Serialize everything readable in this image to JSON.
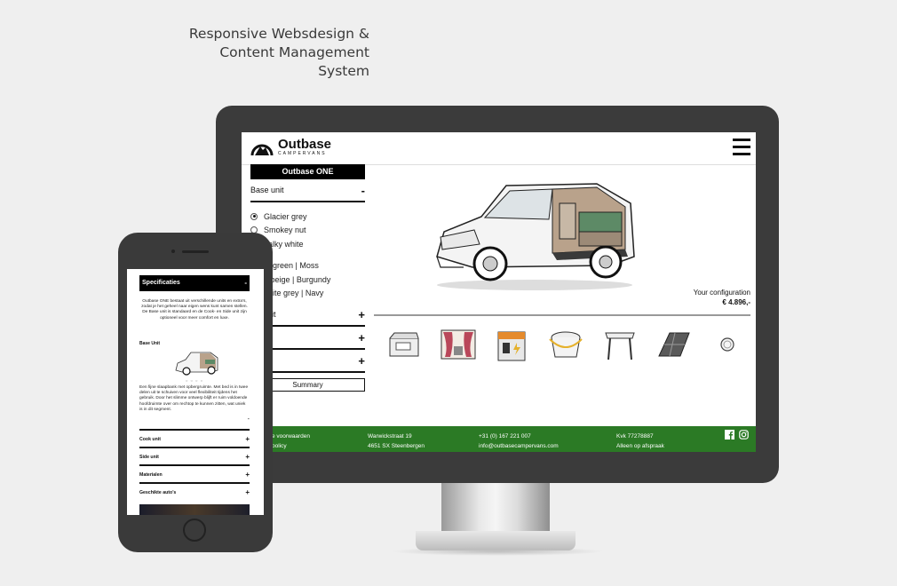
{
  "tagline": [
    "Responsive Websdesign &",
    "Content Management",
    "System"
  ],
  "colors": {
    "footer_green": "#2b7a25",
    "device_dark": "#3b3b3b",
    "background": "#efefef"
  },
  "desktop": {
    "logo": {
      "name": "Outbase",
      "sub": "CAMPERVANS",
      "mark": "mountain-logo-icon"
    },
    "menu_icon": "hamburger-icon",
    "config_title": "Outbase ONE",
    "base_unit": {
      "label": "Base unit",
      "toggle": "-"
    },
    "colors": [
      {
        "label": "Glacier grey",
        "selected": true
      },
      {
        "label": "Smokey nut",
        "selected": false
      },
      {
        "label": "halky white",
        "selected": false
      }
    ],
    "fabrics": [
      {
        "label": "af green | Moss"
      },
      {
        "label": "h beige | Burgundy"
      },
      {
        "label": "anite grey | Navy"
      }
    ],
    "sections": [
      {
        "label": "unit",
        "toggle": "+"
      },
      {
        "label": "nit",
        "toggle": "+"
      },
      {
        "label": "",
        "toggle": "+"
      }
    ],
    "summary_label": "Summary",
    "your_configuration": "Your configuration",
    "price": "€ 4.896,-",
    "thumbnails": [
      "cool-box-icon",
      "curtains-icon",
      "power-station-icon",
      "bucket-toilet-icon",
      "folding-table-icon",
      "solar-panel-icon",
      "light-icon"
    ],
    "footer": {
      "col1": [
        "e voorwaarden",
        "policy"
      ],
      "col2": [
        "Warwickstraat 19",
        "4651 SX Steenbergen"
      ],
      "col3": [
        "+31 (0) 167 221 007",
        "info@outbasecampervans.com"
      ],
      "col4": [
        "Kvk 77278887",
        "Alleen op afspraak"
      ],
      "social": [
        "facebook-icon",
        "instagram-icon"
      ]
    }
  },
  "mobile": {
    "title": "Specificaties",
    "title_toggle": "-",
    "intro": "Outbase ONE bestaat uit verschillende units en extra's, zodat je het geheel naar eigen wens kunt samen stellen. De Base unit is standaard en de Cook- en Side unit zijn optioneel voor meer comfort en luxe.",
    "base_label": "Base Unit",
    "description": "Een fijne slaapbank met opbergruimte. Met bed is in twee delen uit te schuiven voor veel flexibiliteit tijdens het gebruik. Door het slimme ontwerp blijft er ruim voldoende hoofdruimte over om rechtop te kunnen zitten, wat uniek is in dit segment.",
    "minus": "-",
    "sections": [
      {
        "label": "Cook unit",
        "toggle": "+"
      },
      {
        "label": "Side unit",
        "toggle": "+"
      },
      {
        "label": "Materialen",
        "toggle": "+"
      },
      {
        "label": "Geschikte auto's",
        "toggle": "+"
      }
    ]
  }
}
